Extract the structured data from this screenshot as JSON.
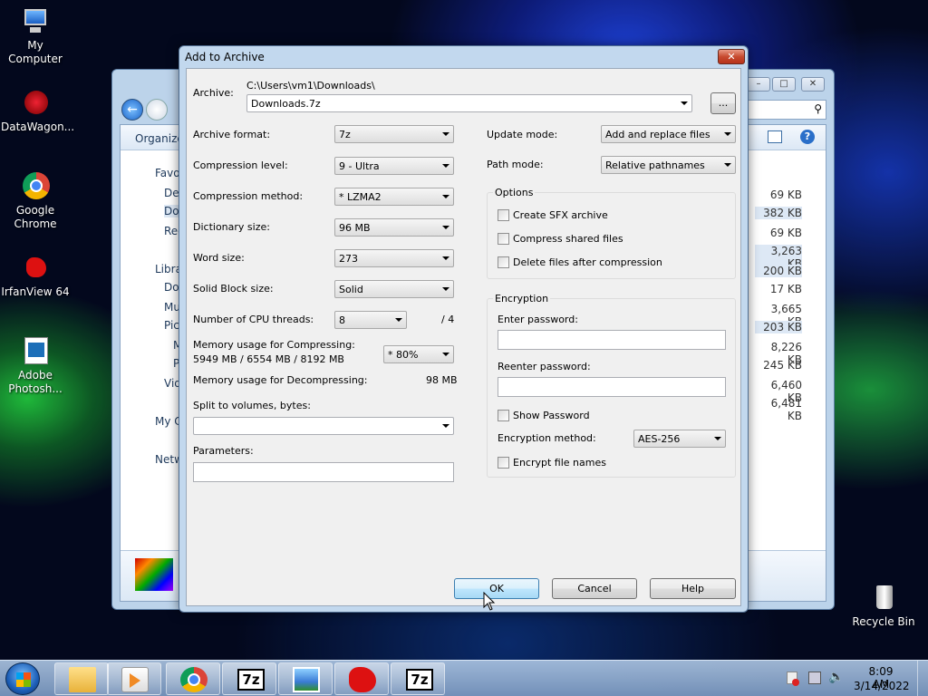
{
  "desktop": {
    "icons": [
      {
        "label": "My Computer"
      },
      {
        "label": "DataWagon..."
      },
      {
        "label": "Google Chrome"
      },
      {
        "label": "IrfanView 64"
      },
      {
        "label": "Adobe Photosh..."
      },
      {
        "label": "Recycle Bin"
      }
    ]
  },
  "explorer": {
    "organize": "Organize",
    "nav": [
      "Favo",
      "Des",
      "Dov",
      "Rec",
      "Libra",
      "Do",
      "Mu",
      "Pic",
      "M",
      "P",
      "Vid",
      "My C",
      "Netw"
    ],
    "sizes": [
      "69 KB",
      "382 KB",
      "69 KB",
      "3,263 KB",
      "200 KB",
      "17 KB",
      "3,665 KB",
      "203 KB",
      "8,226 KB",
      "245 KB",
      "6,460 KB",
      "6,481 KB"
    ]
  },
  "dialog": {
    "title": "Add to Archive",
    "archive_label": "Archive:",
    "archive_path": "C:\\Users\\vm1\\Downloads\\",
    "archive_name": "Downloads.7z",
    "browse": "...",
    "left": {
      "format_label": "Archive format:",
      "format_value": "7z",
      "level_label": "Compression level:",
      "level_value": "9 - Ultra",
      "method_label": "Compression method:",
      "method_value": "* LZMA2",
      "dict_label": "Dictionary size:",
      "dict_value": "96 MB",
      "word_label": "Word size:",
      "word_value": "273",
      "solid_label": "Solid Block size:",
      "solid_value": "Solid",
      "threads_label": "Number of CPU threads:",
      "threads_value": "8",
      "threads_total": "/ 4",
      "mem_comp_label": "Memory usage for Compressing:",
      "mem_comp_value": "5949 MB / 6554 MB / 8192 MB",
      "mem_percent": "* 80%",
      "mem_decomp_label": "Memory usage for Decompressing:",
      "mem_decomp_value": "98 MB",
      "split_label": "Split to volumes, bytes:",
      "params_label": "Parameters:"
    },
    "right": {
      "update_label": "Update mode:",
      "update_value": "Add and replace files",
      "path_label": "Path mode:",
      "path_value": "Relative pathnames",
      "options_title": "Options",
      "sfx": "Create SFX archive",
      "shared": "Compress shared files",
      "delete": "Delete files after compression",
      "enc_title": "Encryption",
      "enter_pw": "Enter password:",
      "reenter_pw": "Reenter password:",
      "show_pw": "Show Password",
      "enc_method_label": "Encryption method:",
      "enc_method_value": "AES-256",
      "enc_names": "Encrypt file names"
    },
    "buttons": {
      "ok": "OK",
      "cancel": "Cancel",
      "help": "Help"
    }
  },
  "taskbar": {
    "time": "8:09 AM",
    "date": "3/14/2022",
    "sevenz_label": "7z"
  }
}
